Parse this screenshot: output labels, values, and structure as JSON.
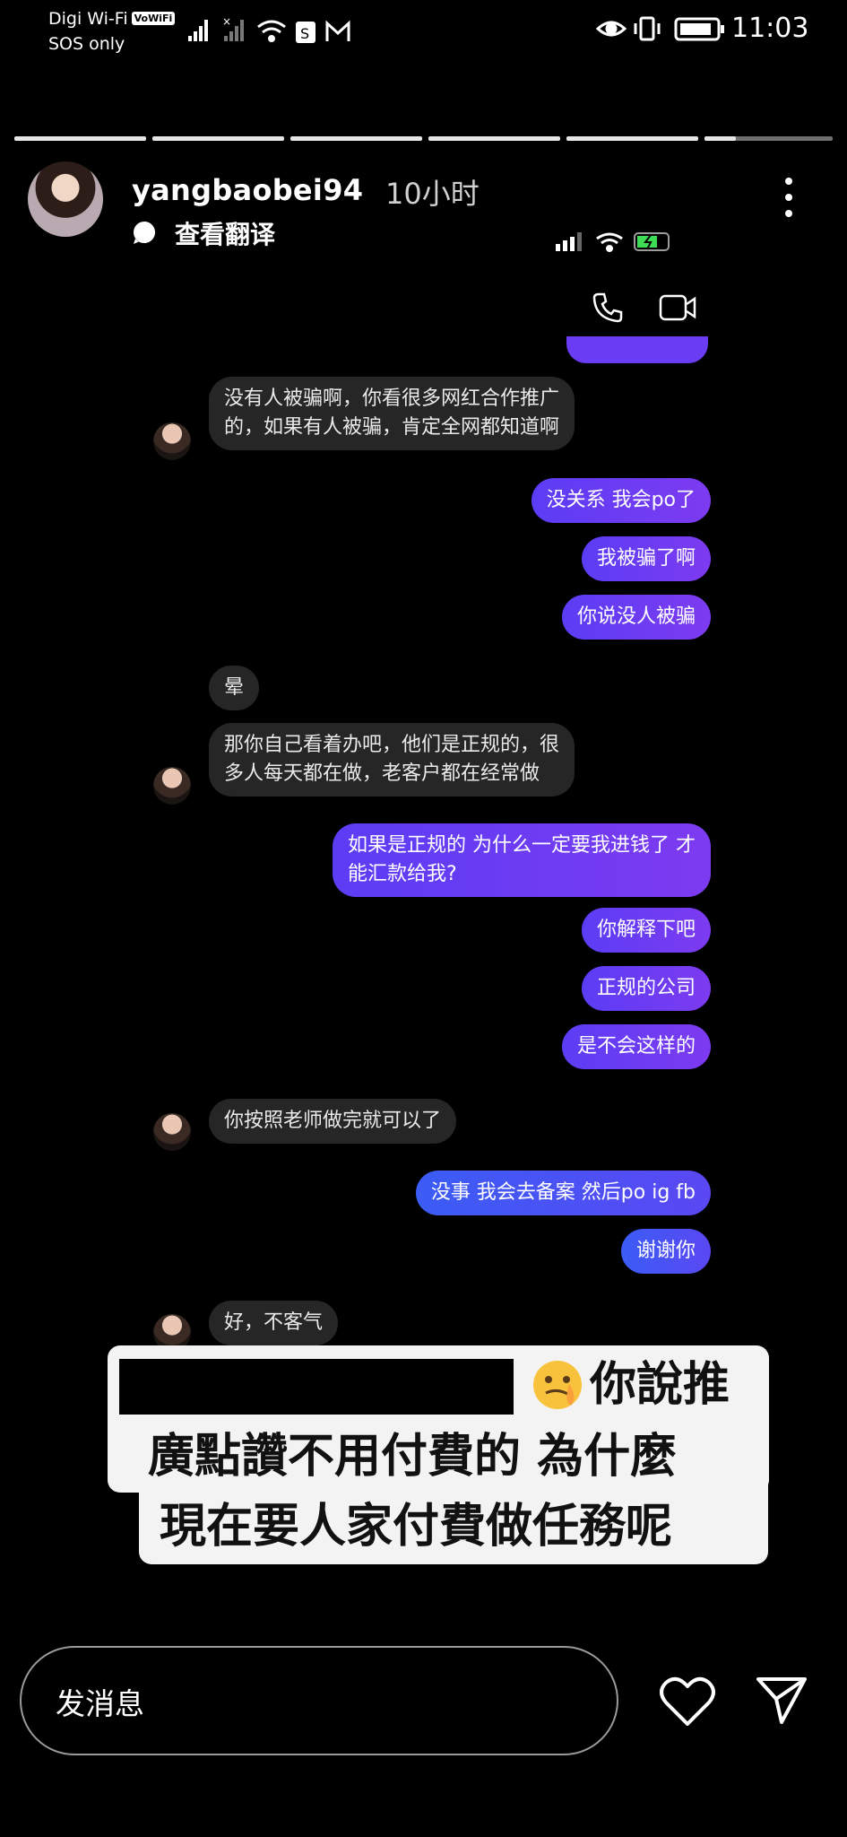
{
  "status_bar": {
    "carrier": "Digi Wi-Fi",
    "carrier_badge": "VoWiFi",
    "sos": "SOS only",
    "time": "11:03"
  },
  "story": {
    "username": "yangbaobei94",
    "time_ago": "10小时",
    "translate_label": "查看翻译",
    "segments": 6
  },
  "chat": {
    "messages": [
      {
        "side": "in",
        "text": "没有人被骗啊，你看很多网红合作推广\n的，如果有人被骗，肯定全网都知道啊"
      },
      {
        "side": "out",
        "text": "没关系 我会po了"
      },
      {
        "side": "out",
        "text": "我被骗了啊"
      },
      {
        "side": "out",
        "text": "你说没人被骗"
      },
      {
        "side": "in",
        "text": "晕"
      },
      {
        "side": "in",
        "text": "那你自己看着办吧，他们是正规的，很\n多人每天都在做，老客户都在经常做"
      },
      {
        "side": "out",
        "text": "如果是正规的 为什么一定要我进钱了 才\n能汇款给我?"
      },
      {
        "side": "out",
        "text": "你解释下吧"
      },
      {
        "side": "out",
        "text": "正规的公司"
      },
      {
        "side": "out",
        "text": "是不会这样的"
      },
      {
        "side": "in",
        "text": "你按照老师做完就可以了"
      },
      {
        "side": "out",
        "text": "没事 我会去备案 然后po ig fb"
      },
      {
        "side": "out",
        "text": "谢谢你"
      },
      {
        "side": "in",
        "text": "好，不客气"
      }
    ]
  },
  "caption": {
    "line1": "你說推",
    "line2": "廣點讚不用付費的 為什麼",
    "line3": "現在要人家付費做任務呢"
  },
  "bottom": {
    "message_placeholder": "发消息"
  },
  "colors": {
    "outgoing_bubble": "#6a3cf3",
    "incoming_bubble": "#262626",
    "caption_bg": "#f3f3f3"
  },
  "icons": [
    "signal-icon",
    "wifi-icon",
    "shopee-icon",
    "gmail-icon",
    "eye-icon",
    "vibrate-icon",
    "battery-icon",
    "more-icon",
    "phone-icon",
    "video-icon",
    "heart-icon",
    "send-icon",
    "emoji-icon"
  ]
}
